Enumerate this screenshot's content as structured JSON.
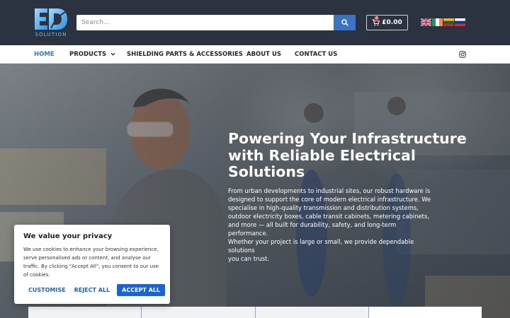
{
  "brand": {
    "logo_text": "SOLUTION",
    "accent": "#3b74c4"
  },
  "search": {
    "placeholder": "Search..."
  },
  "cart": {
    "total": "£0.00",
    "count": "0"
  },
  "languages": [
    "English",
    "Irish",
    "Lithuanian",
    "Russian"
  ],
  "nav": {
    "items": [
      {
        "label": "HOME",
        "active": true
      },
      {
        "label": "PRODUCTS",
        "has_dropdown": true
      },
      {
        "label": "SHIELDING PARTS & ACCESSORIES"
      },
      {
        "label": "ABOUT US"
      },
      {
        "label": "CONTACT US"
      }
    ],
    "social_icon": "instagram-icon"
  },
  "hero": {
    "title_lines": [
      "Powering Your Infrastructure",
      "with Reliable Electrical",
      "Solutions"
    ],
    "body_lines": [
      "From urban developments to industrial sites, our robust hardware is",
      "designed to support the core of modern electrical infrastructure. We",
      "specialise in high-quality transmission and distribution systems,",
      "outdoor electricity boxes, cable transit cabinets, metering cabinets,",
      "and more — all built for durability, safety, and long-term performance.",
      "Whether your project is large or small, we provide dependable",
      "solutions",
      "you can trust."
    ]
  },
  "cookie_banner": {
    "title": "We value your privacy",
    "text": "We use cookies to enhance your browsing experience, serve personalised ads or content, and analyse our traffic. By clicking \"Accept All\", you consent to our use of cookies.",
    "buttons": {
      "customise": "CUSTOMISE",
      "reject": "REJECT ALL",
      "accept": "ACCEPT ALL"
    }
  }
}
